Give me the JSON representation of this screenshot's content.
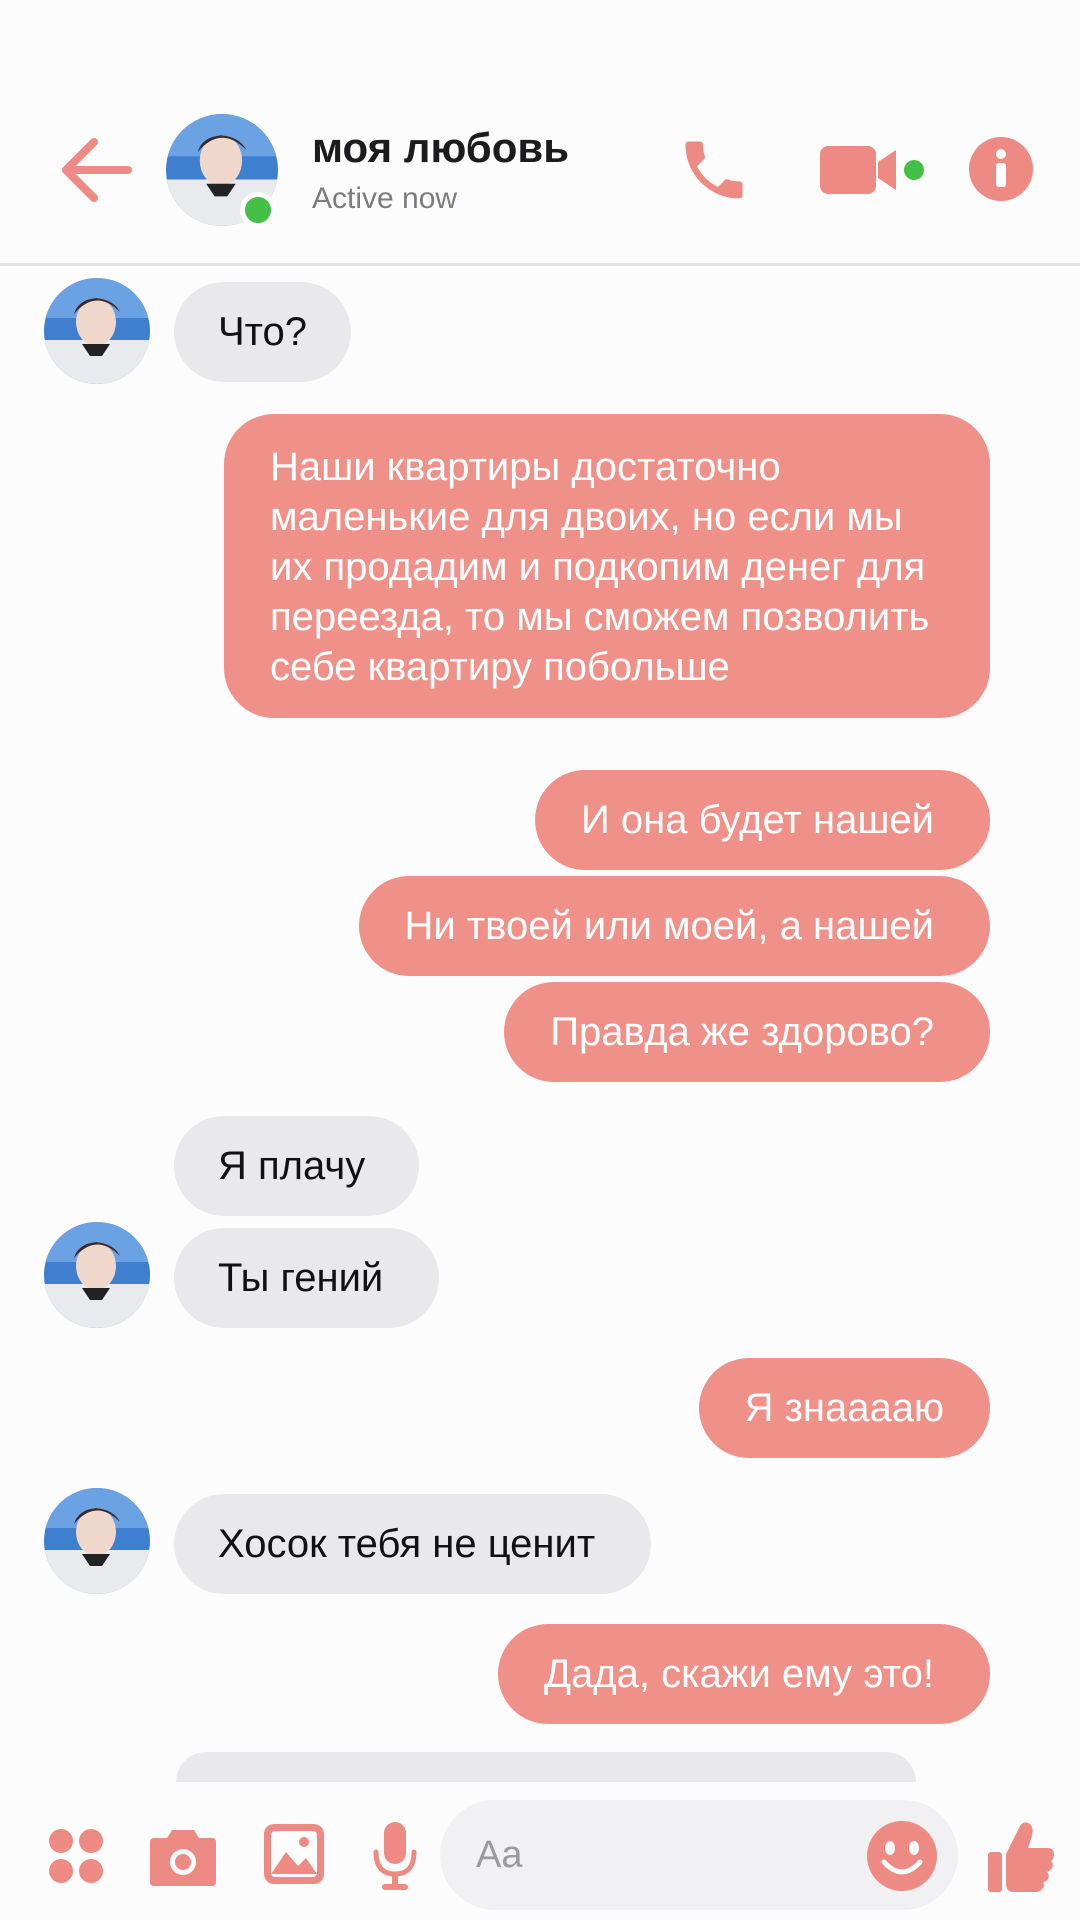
{
  "header": {
    "title": "моя любовь",
    "status": "Active now",
    "accent_color": "#ee8a84",
    "icons": [
      "back-arrow-icon",
      "phone-icon",
      "video-camera-icon",
      "info-icon"
    ]
  },
  "messages": [
    {
      "from": "them",
      "text": "Что?"
    },
    {
      "from": "me",
      "text": "Наши квартиры достаточно маленькие для двоих, но если мы их продадим и подкопим денег для переезда, то мы сможем позволить себе квартиру побольше"
    },
    {
      "from": "me",
      "text": "И она будет нашей"
    },
    {
      "from": "me",
      "text": "Ни твоей или моей, а нашей"
    },
    {
      "from": "me",
      "text": "Правда же здорово?"
    },
    {
      "from": "them",
      "text": "Я плачу"
    },
    {
      "from": "them",
      "text": "Ты гений"
    },
    {
      "from": "me",
      "text": "Я знаааaю"
    },
    {
      "from": "them",
      "text": "Хосок тебя не ценит"
    },
    {
      "from": "me",
      "text": "Дада, скажи ему это!"
    }
  ],
  "composer": {
    "placeholder": "Aa",
    "icons": [
      "apps-icon",
      "camera-icon",
      "image-icon",
      "microphone-icon",
      "emoji-icon",
      "thumbs-up-icon"
    ]
  },
  "colors": {
    "outgoing_bubble": "#ef9089",
    "incoming_bubble": "#e9e8eb",
    "online_indicator": "#44c046"
  }
}
